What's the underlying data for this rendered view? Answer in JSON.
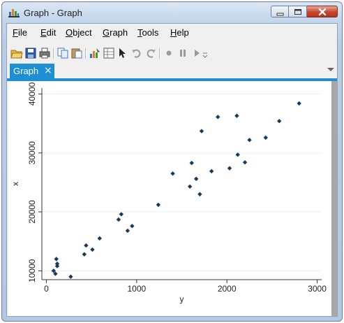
{
  "window": {
    "title": "Graph - Graph",
    "icons": {
      "app": "bar-chart-icon",
      "minimize": "minimize-icon",
      "maximize": "maximize-icon",
      "close": "close-icon"
    }
  },
  "menu": {
    "file": "File",
    "edit": "Edit",
    "object": "Object",
    "graph": "Graph",
    "tools": "Tools",
    "help": "Help"
  },
  "toolbar": {
    "icons": [
      "open-folder-icon",
      "save-icon",
      "print-icon",
      "copy-icon",
      "paste-icon",
      "graph-editor-icon",
      "data-editor-icon",
      "pointer-icon",
      "undo-icon",
      "redo-icon",
      "record-icon",
      "pause-icon",
      "play-icon",
      "dropdown-icon"
    ]
  },
  "tabs": [
    {
      "label": "Graph",
      "close": "×"
    }
  ],
  "colors": {
    "tab_accent": "#1e8fd3",
    "marker": "#1a3a5c",
    "title_bar": "#c4d6ec"
  },
  "chart_data": {
    "type": "scatter",
    "xlabel": "y",
    "ylabel": "x",
    "xlim": [
      -50,
      3050
    ],
    "ylim": [
      8500,
      41000
    ],
    "x_ticks": [
      0,
      1000,
      2000,
      3000
    ],
    "y_ticks": [
      10000,
      20000,
      30000,
      40000
    ],
    "x_tick_labels": [
      "0",
      "1000",
      "2000",
      "3000"
    ],
    "y_tick_labels": [
      "10000",
      "20000",
      "30000",
      "40000"
    ],
    "grid": true,
    "series": [
      {
        "x": [
          110,
          80,
          120,
          100,
          120,
          270,
          420,
          440,
          510,
          590,
          800,
          830,
          900,
          950,
          1240,
          1400,
          1590,
          1610,
          1660,
          1700,
          1720,
          1830,
          1900,
          2030,
          2110,
          2120,
          2200,
          2250,
          2430,
          2580,
          2800
        ],
        "y": [
          12000,
          10000,
          10800,
          9500,
          11200,
          9000,
          12800,
          14300,
          13600,
          15500,
          18700,
          19600,
          16800,
          17600,
          21200,
          26500,
          24300,
          28300,
          25600,
          23000,
          33700,
          26900,
          36100,
          27400,
          36300,
          29700,
          28400,
          32200,
          32600,
          35400,
          38400
        ]
      }
    ]
  }
}
